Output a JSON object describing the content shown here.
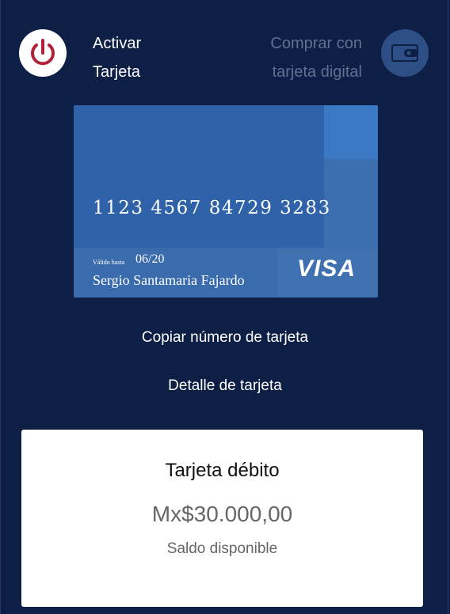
{
  "actions": {
    "activate_label_line1": "Activar",
    "activate_label_line2": "Tarjeta",
    "activate_icon": "power-icon",
    "digital_label_line1": "Comprar con",
    "digital_label_line2": "tarjeta digital",
    "digital_icon": "wallet-icon"
  },
  "card": {
    "number": "1123 4567 84729 3283",
    "valid_label": "Válido hasta",
    "valid_value": "06/20",
    "holder": "Sergio Santamaria Fajardo",
    "brand": "VISA"
  },
  "links": {
    "copy_number": "Copiar número de tarjeta",
    "card_detail": "Detalle de tarjeta"
  },
  "balance": {
    "title": "Tarjeta débito",
    "amount": "Mx$30.000,00",
    "caption": "Saldo disponible"
  },
  "colors": {
    "background": "#0e1f45",
    "power_icon": "#b0223a",
    "card_base": "#3f70b0",
    "wallet_circle": "#2e4f85",
    "panel": "#ffffff"
  }
}
